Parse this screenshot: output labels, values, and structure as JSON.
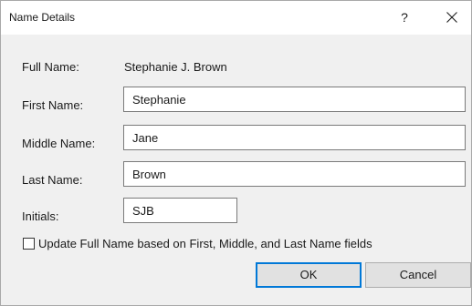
{
  "window": {
    "title": "Name Details",
    "help_label": "?",
    "close_icon": "close-icon"
  },
  "form": {
    "full_name_label": "Full Name:",
    "full_name_value": "Stephanie J. Brown",
    "first_name_label": "First Name:",
    "first_name_value": "Stephanie",
    "middle_name_label": "Middle Name:",
    "middle_name_value": "Jane",
    "last_name_label": "Last Name:",
    "last_name_value": "Brown",
    "initials_label": "Initials:",
    "initials_value": "SJB"
  },
  "update_checkbox": {
    "label": "Update Full Name based on First, Middle, and Last Name fields",
    "checked": false
  },
  "buttons": {
    "ok_label": "OK",
    "cancel_label": "Cancel"
  },
  "colors": {
    "accent": "#0078d7",
    "dialog_background": "#f0f0f0",
    "titlebar_background": "#ffffff"
  }
}
